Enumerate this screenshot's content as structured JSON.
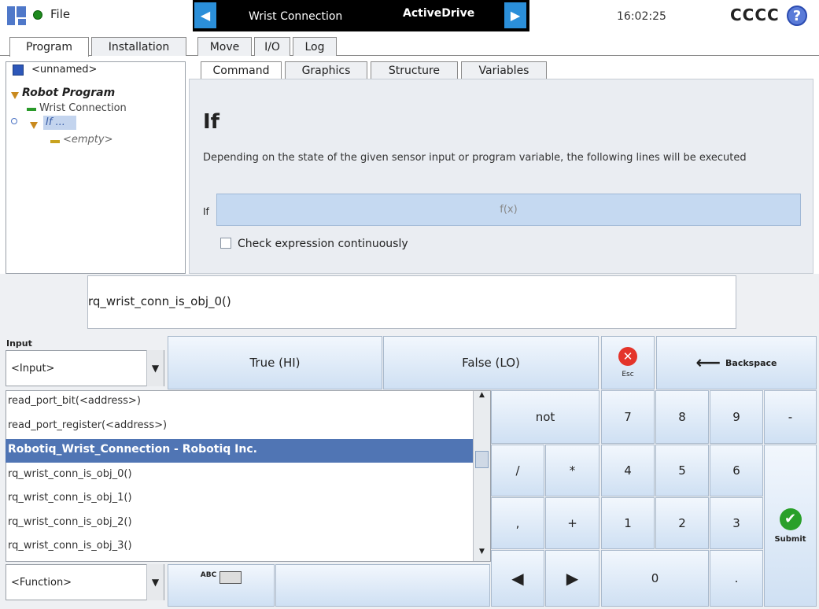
{
  "topbar": {
    "file_label": "File",
    "nav_title": "Wrist Connection",
    "nav_drive": "ActiveDrive",
    "clock": "16:02:25",
    "robot_name": "CCCC",
    "help": "?"
  },
  "tabs": [
    "Program",
    "Installation",
    "Move",
    "I/O",
    "Log"
  ],
  "program": {
    "file_name": "<unnamed>",
    "tree": {
      "root": "Robot Program",
      "wrist": "Wrist Connection",
      "if": "If ...",
      "empty": "<empty>"
    }
  },
  "subtabs": [
    "Command",
    "Graphics",
    "Structure",
    "Variables"
  ],
  "command": {
    "title": "If",
    "description": "Depending on the state of the given sensor input or program variable, the following lines will be executed",
    "if_label": "If",
    "expression_placeholder": "f(x)",
    "checkbox_label": "Check expression continuously"
  },
  "editor": {
    "expression": "rq_wrist_conn_is_obj_0()",
    "input_caption": "Input",
    "input_select": "<Input>",
    "true_label": "True (HI)",
    "false_label": "False (LO)",
    "esc_label": "Esc",
    "backspace_label": "Backspace",
    "function_select": "<Function>",
    "abc_label": "ABC",
    "submit_label": "Submit",
    "functions": [
      "read_port_bit(<address>)",
      "read_port_register(<address>)",
      "Robotiq_Wrist_Connection - Robotiq Inc.",
      "rq_wrist_conn_is_obj_0()",
      "rq_wrist_conn_is_obj_1()",
      "rq_wrist_conn_is_obj_2()",
      "rq_wrist_conn_is_obj_3()"
    ],
    "keys": {
      "not": "not",
      "k7": "7",
      "k8": "8",
      "k9": "9",
      "minus": "-",
      "div": "/",
      "mul": "*",
      "k4": "4",
      "k5": "5",
      "k6": "6",
      "comma": ",",
      "plus": "+",
      "k1": "1",
      "k2": "2",
      "k3": "3",
      "left": "◀",
      "right": "▶",
      "k0": "0",
      "dot": "."
    }
  },
  "colors": {
    "accent_blue": "#2b8fd9",
    "selection": "#5075b4",
    "panel": "#eaedf2"
  }
}
